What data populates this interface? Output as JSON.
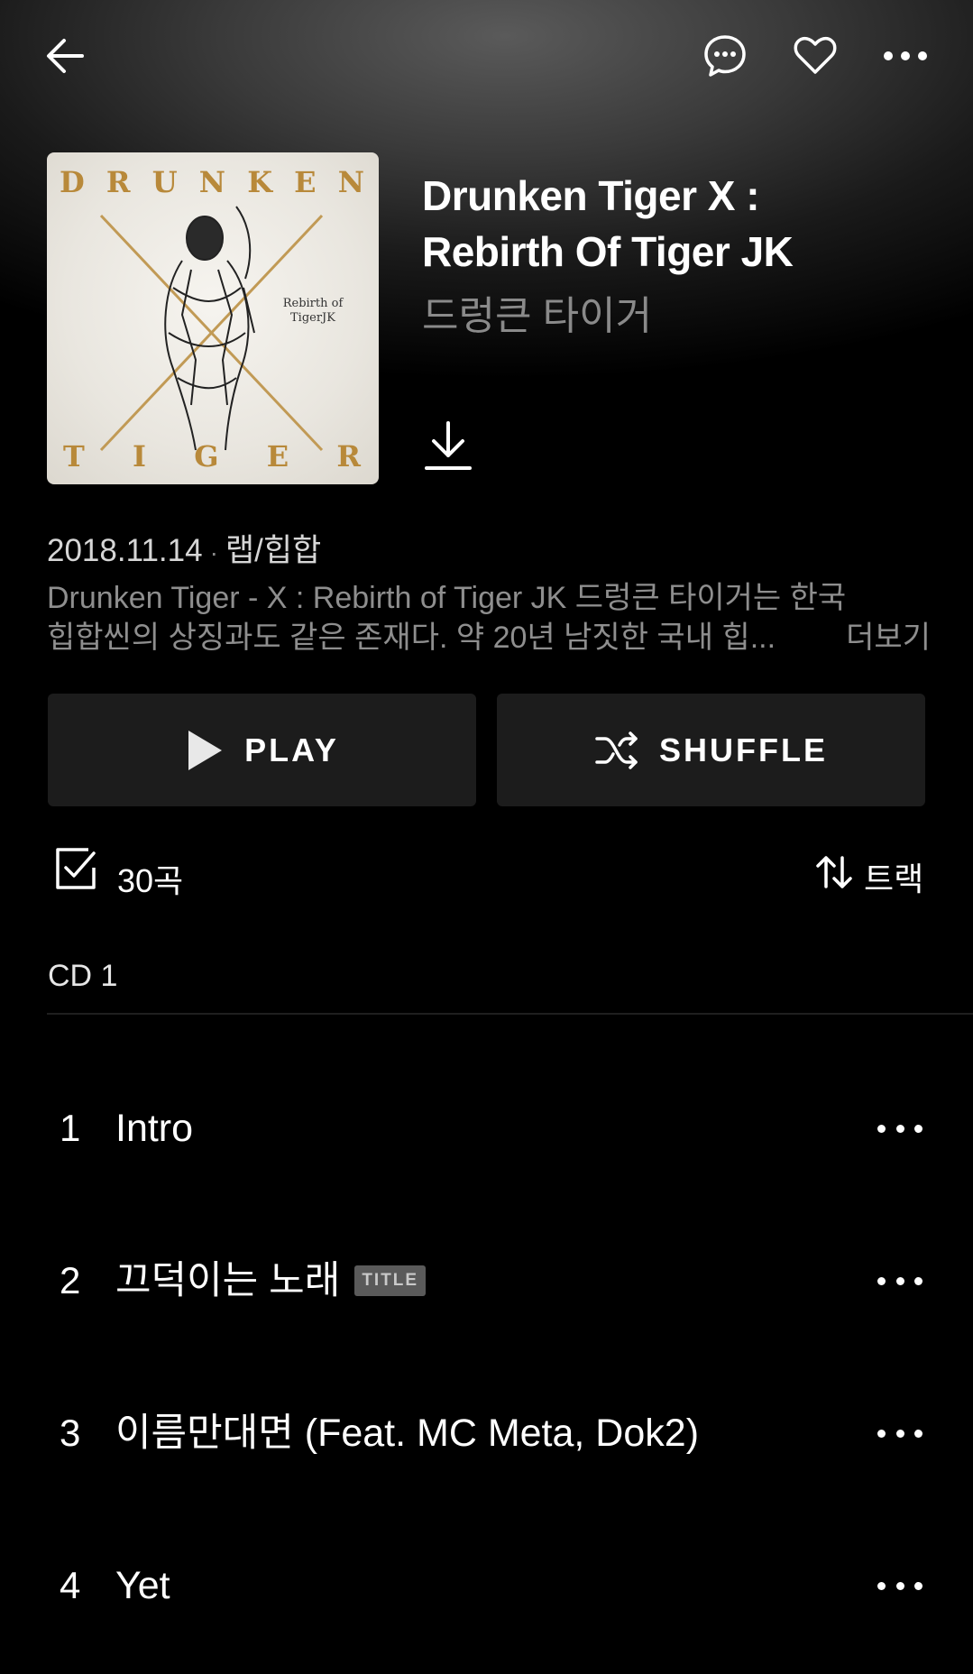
{
  "header": {
    "back_icon": "back-arrow-icon",
    "comment_icon": "comment-icon",
    "like_icon": "heart-icon",
    "more_icon": "more-horizontal-icon"
  },
  "album": {
    "cover_letters_top": [
      "D",
      "R",
      "U",
      "N",
      "K",
      "E",
      "N"
    ],
    "cover_letters_bottom": [
      "T",
      "I",
      "G",
      "E",
      "R"
    ],
    "cover_subtitle": "Rebirth of TigerJK",
    "title_line1": "Drunken Tiger X :",
    "title_line2": "Rebirth Of Tiger JK",
    "artist": "드렁큰 타이거",
    "download_icon": "download-icon",
    "release_date": "2018.11.14",
    "genre": "랩/힙합",
    "description_line1": "Drunken Tiger - X : Rebirth of Tiger JK 드렁큰 타이거는 한국",
    "description_line2": "힙합씬의 상징과도 같은 존재다. 약 20년 남짓한 국내 힙...",
    "more_label": "더보기"
  },
  "actions": {
    "play_label": "PLAY",
    "shuffle_label": "SHUFFLE"
  },
  "tracklist": {
    "count_label": "30곡",
    "sort_label": "트랙",
    "disc_label": "CD 1",
    "tracks": [
      {
        "number": "1",
        "title": "Intro",
        "badge": ""
      },
      {
        "number": "2",
        "title": "끄덕이는 노래",
        "badge": "TITLE"
      },
      {
        "number": "3",
        "title": "이름만대면 (Feat. MC Meta, Dok2)",
        "badge": ""
      },
      {
        "number": "4",
        "title": "Yet",
        "badge": ""
      }
    ]
  }
}
